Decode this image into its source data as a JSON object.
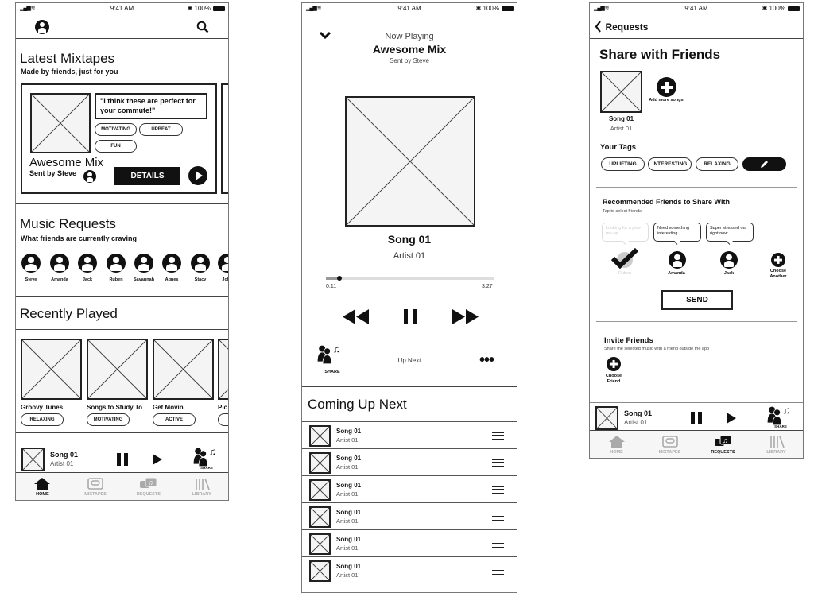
{
  "status": {
    "time": "9:41 AM",
    "battery": "100%",
    "bluetooth_icon": "bluetooth-icon",
    "signal_icon": "signal-icon"
  },
  "home": {
    "latest": {
      "title": "Latest Mixtapes",
      "subtitle": "Made by friends, just for you",
      "card": {
        "quote": "\"I think these are perfect for your commute!\"",
        "tags": [
          "MOTIVATING",
          "UPBEAT",
          "FUN"
        ],
        "title": "Awesome Mix",
        "sender": "Sent by Steve",
        "details_label": "DETAILS"
      }
    },
    "requests": {
      "title": "Music Requests",
      "subtitle": "What friends are currently craving",
      "friends": [
        "Steve",
        "Amanda",
        "Jack",
        "Ruben",
        "Savannah",
        "Agnes",
        "Stacy",
        "John"
      ]
    },
    "recent": {
      "title": "Recently Played",
      "items": [
        {
          "name": "Groovy Tunes",
          "tag": "RELAXING"
        },
        {
          "name": "Songs to Study To",
          "tag": "MOTIVATING"
        },
        {
          "name": "Get Movin'",
          "tag": "ACTIVE"
        },
        {
          "name": "Pic",
          "tag": "IN"
        }
      ]
    }
  },
  "mini_player": {
    "song": "Song 01",
    "artist": "Artist 01",
    "share_label": "SHARE"
  },
  "tabs": [
    {
      "label": "HOME"
    },
    {
      "label": "MIXTAPES"
    },
    {
      "label": "REQUESTS"
    },
    {
      "label": "LIBRARY"
    }
  ],
  "now_playing": {
    "header": "Now Playing",
    "title": "Awesome Mix",
    "sender": "Sent by Steve",
    "song": "Song 01",
    "artist": "Artist 01",
    "elapsed": "0:11",
    "duration": "3:27",
    "progress": 0.08,
    "share_label": "SHARE",
    "up_next_label": "Up Next",
    "queue_title": "Coming Up Next",
    "queue": [
      {
        "song": "Song 01",
        "artist": "Artist 01"
      },
      {
        "song": "Song 01",
        "artist": "Artist 01"
      },
      {
        "song": "Song 01",
        "artist": "Artist 01"
      },
      {
        "song": "Song 01",
        "artist": "Artist 01"
      },
      {
        "song": "Song 01",
        "artist": "Artist 01"
      },
      {
        "song": "Song 01",
        "artist": "Artist 01"
      }
    ]
  },
  "share": {
    "back_label": "Requests",
    "title": "Share with Friends",
    "song": "Song 01",
    "artist": "Artist 01",
    "add_more_label": "Add more songs",
    "tags_title": "Your Tags",
    "tags": [
      "UPLIFTING",
      "INTERESTING",
      "RELAXING"
    ],
    "recommended_title": "Recommended Friends to Share With",
    "recommended_subtitle": "Tap to select friends",
    "friends": [
      {
        "name": "Ruben",
        "bubble": "Looking for a pick-me-up...",
        "selected": true
      },
      {
        "name": "Amanda",
        "bubble": "Need something interesting",
        "selected": false
      },
      {
        "name": "Jack",
        "bubble": "Super stressed out right now",
        "selected": false
      }
    ],
    "choose_another_label": "Choose Another",
    "send_label": "SEND",
    "invite_title": "Invite Friends",
    "invite_subtitle": "Share the selected music with a friend outside the app",
    "choose_friend_label": "Choose Friend"
  }
}
